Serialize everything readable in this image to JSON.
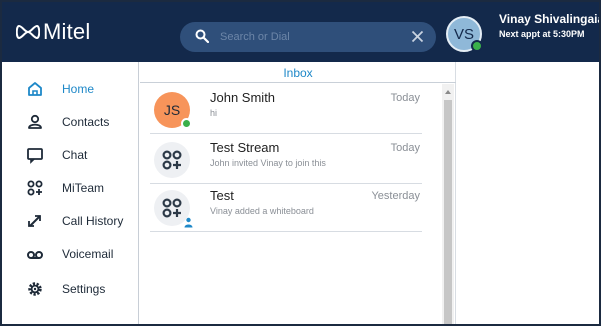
{
  "header": {
    "brand_name": "Mitel",
    "search_placeholder": "Search or Dial",
    "user_initials": "VS",
    "user_name": "Vinay Shivalingaiah",
    "user_status": "Next appt at 5:30PM",
    "colors": {
      "header_bg": "#13294b",
      "search_bg": "#2f4f7a",
      "presence": "#3ab04a"
    }
  },
  "sidebar": {
    "items": [
      {
        "label": "Home",
        "icon": "home-icon",
        "active": true
      },
      {
        "label": "Contacts",
        "icon": "contacts-icon",
        "active": false
      },
      {
        "label": "Chat",
        "icon": "chat-icon",
        "active": false
      },
      {
        "label": "MiTeam",
        "icon": "miteam-icon",
        "active": false
      },
      {
        "label": "Call History",
        "icon": "call-history-icon",
        "active": false
      },
      {
        "label": "Voicemail",
        "icon": "voicemail-icon",
        "active": false
      },
      {
        "label": "Settings",
        "icon": "settings-icon",
        "active": false
      }
    ],
    "accent": "#1e88c8"
  },
  "inbox": {
    "title": "Inbox",
    "conversations": [
      {
        "name": "John Smith",
        "initials": "JS",
        "preview": "hi",
        "time": "Today",
        "avatar": "initials",
        "avatar_color": "#f7945a"
      },
      {
        "name": "Test Stream",
        "preview": "John invited Vinay to join this",
        "time": "Today",
        "avatar": "group-stream-icon"
      },
      {
        "name": "Test",
        "preview": "Vinay added a whiteboard",
        "time": "Yesterday",
        "avatar": "group-stream-icon"
      }
    ]
  }
}
